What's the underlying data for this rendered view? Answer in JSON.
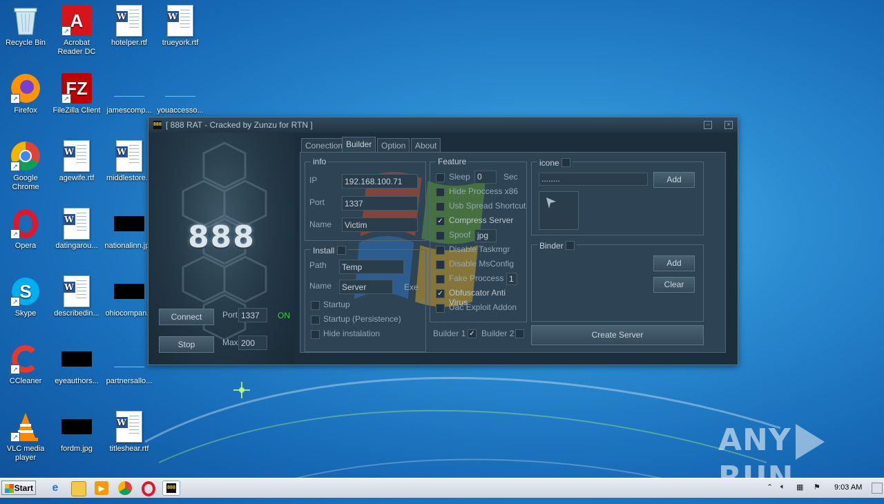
{
  "desktop": {
    "icons": [
      {
        "label": "Recycle Bin"
      },
      {
        "label": "Acrobat Reader DC"
      },
      {
        "label": "hotelper.rtf"
      },
      {
        "label": "trueyork.rtf"
      },
      {
        "label": "Firefox"
      },
      {
        "label": "FileZilla Client"
      },
      {
        "label": "jamescomp..."
      },
      {
        "label": "youaccesso..."
      },
      {
        "label": "Google Chrome"
      },
      {
        "label": "agewife.rtf"
      },
      {
        "label": "middlestore..."
      },
      {
        "label": "Opera"
      },
      {
        "label": "datingarou..."
      },
      {
        "label": "nationalinn.jpg"
      },
      {
        "label": "Skype"
      },
      {
        "label": "describedin..."
      },
      {
        "label": "ohiocompan..."
      },
      {
        "label": "CCleaner"
      },
      {
        "label": "eyeauthors..."
      },
      {
        "label": "partnersallo..."
      },
      {
        "label": "VLC media player"
      },
      {
        "label": "fordm.jpg"
      },
      {
        "label": "titleshear.rtf"
      }
    ],
    "watermark": {
      "left": "ANY",
      "right": "RUN"
    }
  },
  "rat_window": {
    "title": "[ 888 RAT - Cracked by Zunzu for RTN ]",
    "logo_text": "888",
    "minimize_glyph": "–",
    "close_glyph": "×",
    "left_panel": {
      "connect_label": "Connect",
      "stop_label": "Stop",
      "port_label": "Port",
      "port_value": "1337",
      "status": "ON",
      "max_label": "Max",
      "max_value": "200"
    },
    "tabs": [
      {
        "label": "Conection"
      },
      {
        "label": "Builder"
      },
      {
        "label": "Option"
      },
      {
        "label": "About"
      }
    ],
    "info": {
      "title": "info",
      "ip_label": "IP",
      "ip_value": "192.168.100.71",
      "port_label": "Port",
      "port_value": "1337",
      "name_label": "Name",
      "name_value": "Victim"
    },
    "install": {
      "title": "Install",
      "path_label": "Path",
      "path_value": "Temp",
      "name_label": "Name",
      "name_value": "Server",
      "ext": "Exe",
      "options": [
        {
          "label": "Startup",
          "checked": false
        },
        {
          "label": "Startup (Persistence)",
          "checked": false
        },
        {
          "label": "Hide instalation",
          "checked": false
        }
      ]
    },
    "feature": {
      "title": "Feature",
      "sleep_label": "Sleep",
      "sleep_value": "0",
      "sleep_unit": "Sec",
      "items": [
        {
          "label": "Hide Proccess x86",
          "checked": false
        },
        {
          "label": "Usb Spread Shortcut",
          "checked": false
        },
        {
          "label": "Compress Server",
          "checked": true
        },
        {
          "label": "Spoof",
          "checked": false
        },
        {
          "label": "Disable Taskmgr",
          "checked": false
        },
        {
          "label": "Disable MsConfig",
          "checked": false
        },
        {
          "label": "Fake Proccess",
          "checked": false
        },
        {
          "label": "Obfuscator Anti Virus",
          "checked": true
        },
        {
          "label": "Uac Exploit Addon",
          "checked": false
        }
      ],
      "spoof_value": "jpg",
      "fake_value": "1"
    },
    "icone": {
      "title": "icone",
      "path_value": "........",
      "add_label": "Add"
    },
    "binder": {
      "title": "Binder",
      "add_label": "Add",
      "clear_label": "Clear"
    },
    "builder1_label": "Builder 1",
    "builder1_checked": true,
    "builder2_label": "Builder 2",
    "create_label": "Create Server"
  },
  "taskbar": {
    "start_label": "Start",
    "clock": "9:03 AM",
    "pinned": [
      {
        "icon": "internet-explorer-icon"
      },
      {
        "icon": "file-explorer-icon"
      },
      {
        "icon": "media-player-icon"
      },
      {
        "icon": "chrome-icon"
      },
      {
        "icon": "opera-icon"
      },
      {
        "icon": "rat-app-icon"
      }
    ]
  }
}
